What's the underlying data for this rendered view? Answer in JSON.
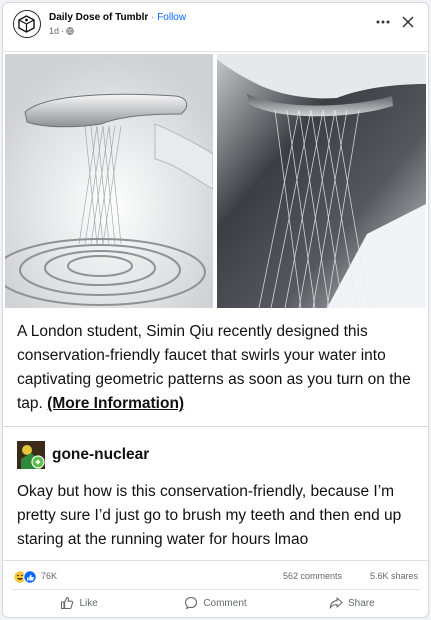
{
  "post": {
    "page_name": "Daily Dose of Tumblr",
    "separator": "·",
    "follow_label": "Follow",
    "time": "1d",
    "audience_sep": "·",
    "more_icon": "more-dots-icon",
    "close_icon": "close-icon"
  },
  "content": {
    "caption_main": "A London student, Simin Qiu recently designed this conservation-friendly faucet that swirls your water into captivating geometric patterns as soon as you turn on the tap. ",
    "caption_link": "(More Information)",
    "reblog_user": "gone-nuclear",
    "reblog_text": "Okay but how is this conservation-friendly, because I’m pretty sure I’d just go to brush my teeth and then end up staring at the running water for hours lmao"
  },
  "stats": {
    "reactions": "76K",
    "comments": "562 comments",
    "shares": "5.6K shares"
  },
  "actions": {
    "like": "Like",
    "comment": "Comment",
    "share": "Share"
  },
  "colors": {
    "accent": "#0866ff",
    "muted": "#65676b"
  }
}
